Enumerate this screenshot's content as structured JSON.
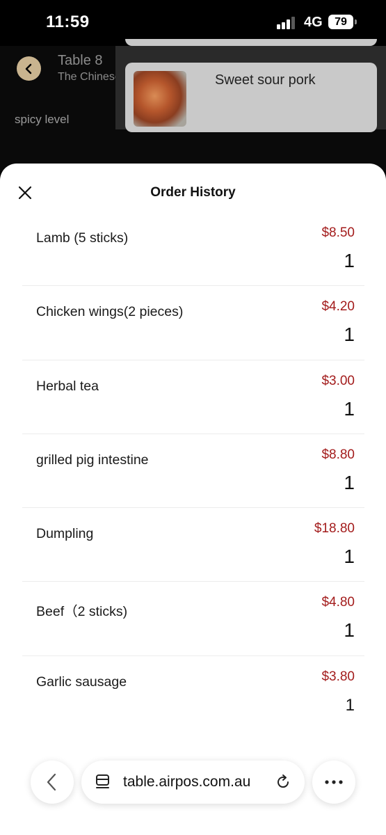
{
  "status": {
    "time": "11:59",
    "network": "4G",
    "battery": "79"
  },
  "background": {
    "table_title": "Table 8",
    "restaurant": "The Chinese Charcoal BBQ House",
    "sidebar_label": "spicy level",
    "food_item": "Sweet sour pork",
    "icons": [
      "chevron-left-icon",
      "clipboard-list-icon"
    ]
  },
  "sheet": {
    "title": "Order History",
    "orders": [
      {
        "name": "Lamb (5 sticks)",
        "price": "$8.50",
        "qty": "1"
      },
      {
        "name": "Chicken wings(2 pieces)",
        "price": "$4.20",
        "qty": "1"
      },
      {
        "name": "Herbal tea",
        "price": "$3.00",
        "qty": "1"
      },
      {
        "name": "grilled pig intestine",
        "price": "$8.80",
        "qty": "1"
      },
      {
        "name": "Dumpling",
        "price": "$18.80",
        "qty": "1"
      },
      {
        "name": "Beef（2 sticks)",
        "price": "$4.80",
        "qty": "1"
      },
      {
        "name": "Garlic sausage",
        "price": "$3.80",
        "qty": "1"
      }
    ]
  },
  "browser": {
    "url": "table.airpos.com.au"
  },
  "colors": {
    "price": "#a31c1c",
    "accent": "#c9b48f",
    "sheet_bg": "#ffffff"
  }
}
